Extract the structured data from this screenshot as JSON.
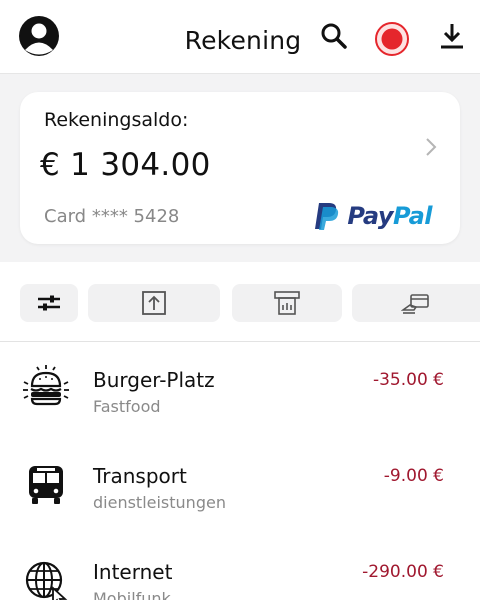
{
  "header": {
    "title": "Rekening",
    "icons": [
      "avatar-icon",
      "search-icon",
      "record-icon",
      "download-icon"
    ],
    "record_color": "#e5262c"
  },
  "balance_card": {
    "label": "Rekeningsaldo:",
    "amount": "€ 1 304.00",
    "card_number": "Card **** 5428",
    "provider_pay": "Pay",
    "provider_pal": "Pal"
  },
  "actions": [
    {
      "icon": "filter-sliders-icon"
    },
    {
      "icon": "transfer-up-icon"
    },
    {
      "icon": "atm-icon"
    },
    {
      "icon": "card-payment-icon"
    }
  ],
  "transactions": [
    {
      "name": "Burger-Platz",
      "category": "Fastfood",
      "amount": "-35.00 €",
      "icon": "burger-icon"
    },
    {
      "name": "Transport",
      "category": "dienstleistungen",
      "amount": "-9.00 €",
      "icon": "bus-icon"
    },
    {
      "name": "Internet",
      "category": "Mobilfunk",
      "amount": "-290.00 €",
      "icon": "globe-icon"
    }
  ],
  "colors": {
    "negative_amount": "#a0182f",
    "paypal_dark": "#253b80",
    "paypal_light": "#179bd7"
  }
}
